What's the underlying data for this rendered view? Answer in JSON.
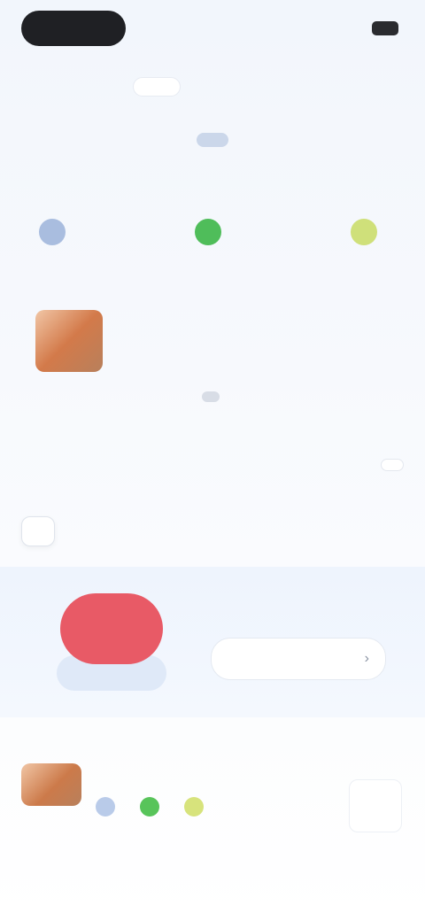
{
  "topbar": {
    "pill_label": "",
    "right_text": ""
  },
  "nav": {
    "items": [
      "",
      "",
      "",
      ""
    ]
  },
  "hero": {
    "badge": "",
    "subtitle": ""
  },
  "quick": {
    "items": [
      {
        "label": "",
        "color": "#a9bddf"
      },
      {
        "label": "",
        "color": "#4fbd5a"
      },
      {
        "label": "",
        "color": "#cfe07a"
      }
    ]
  },
  "row1": {
    "title": "",
    "right": "",
    "desc": "",
    "meta": [
      "",
      "",
      ""
    ]
  },
  "section": {
    "left": "",
    "right": ""
  },
  "tabs": {
    "items": [
      "",
      "",
      "",
      ""
    ]
  },
  "promo": {
    "title": "",
    "button": "",
    "chevron": "›"
  },
  "row2": {
    "title": "",
    "right": "",
    "icons": [
      {
        "label": "",
        "color": "#b9cbe9"
      },
      {
        "label": "",
        "color": "#58c45a"
      },
      {
        "label": "",
        "color": "#d7e37c"
      }
    ]
  }
}
